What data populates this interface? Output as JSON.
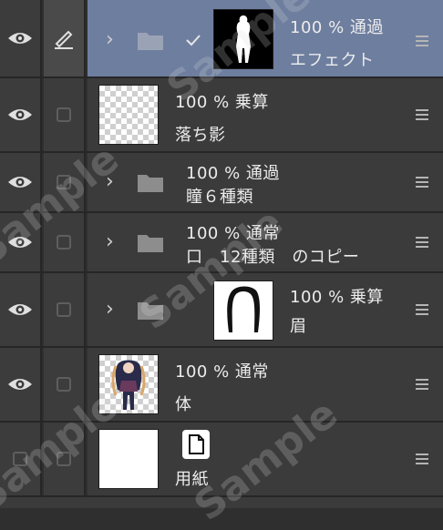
{
  "layers": [
    {
      "opacity": "100 %",
      "blend": "通過",
      "name": "エフェクト",
      "type": "folder-mask",
      "selected": true,
      "editing": true
    },
    {
      "opacity": "100 %",
      "blend": "乗算",
      "name": "落ち影",
      "type": "raster"
    },
    {
      "opacity": "100 %",
      "blend": "通過",
      "name": "瞳６種類",
      "type": "folder"
    },
    {
      "opacity": "100 %",
      "blend": "通常",
      "name": "口　12種類　のコピー",
      "type": "folder"
    },
    {
      "opacity": "100 %",
      "blend": "乗算",
      "name": "眉",
      "type": "folder-mask"
    },
    {
      "opacity": "100 %",
      "blend": "通常",
      "name": "体",
      "type": "raster-character"
    },
    {
      "name": "用紙",
      "type": "paper"
    }
  ],
  "watermark": "Sample",
  "colors": {
    "selected_row": "#6e7e9f",
    "row": "#3b3b3b",
    "background": "#2f2f2f"
  }
}
